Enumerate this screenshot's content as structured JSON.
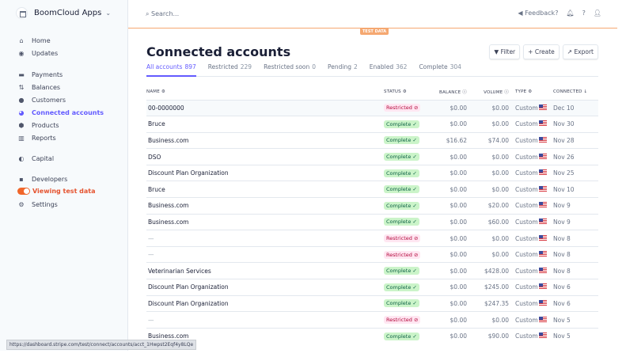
{
  "sidebar": {
    "brand": "BoomCloud Apps",
    "items": [
      {
        "label": "Home",
        "icon": "home-icon"
      },
      {
        "label": "Updates",
        "icon": "updates-icon"
      },
      {
        "label": "Payments",
        "icon": "payments-icon"
      },
      {
        "label": "Balances",
        "icon": "balances-icon"
      },
      {
        "label": "Customers",
        "icon": "customers-icon"
      },
      {
        "label": "Connected accounts",
        "icon": "connected-icon"
      },
      {
        "label": "Products",
        "icon": "products-icon"
      },
      {
        "label": "Reports",
        "icon": "reports-icon"
      },
      {
        "label": "Capital",
        "icon": "capital-icon"
      },
      {
        "label": "Developers",
        "icon": "developers-icon"
      },
      {
        "label": "Viewing test data",
        "icon": "toggle"
      },
      {
        "label": "Settings",
        "icon": "gear-icon"
      }
    ]
  },
  "topbar": {
    "search_placeholder": "Search...",
    "feedback": "Feedback?",
    "test_badge": "TEST DATA"
  },
  "page": {
    "title": "Connected accounts",
    "filter": "Filter",
    "create": "Create",
    "export": "Export"
  },
  "tabs": [
    {
      "label": "All accounts",
      "count": "897"
    },
    {
      "label": "Restricted",
      "count": "229"
    },
    {
      "label": "Restricted soon",
      "count": "0"
    },
    {
      "label": "Pending",
      "count": "2"
    },
    {
      "label": "Enabled",
      "count": "362"
    },
    {
      "label": "Complete",
      "count": "304"
    }
  ],
  "columns": {
    "name": "NAME",
    "status": "STATUS",
    "balance": "BALANCE",
    "volume": "VOLUME",
    "type": "TYPE",
    "connected": "CONNECTED"
  },
  "rows": [
    {
      "name": "00-0000000",
      "status": "Restricted",
      "balance": "$0.00",
      "volume": "$0.00",
      "type": "Custom",
      "connected": "Dec 10"
    },
    {
      "name": "Bruce",
      "status": "Complete",
      "balance": "$0.00",
      "volume": "$0.00",
      "type": "Custom",
      "connected": "Nov 30"
    },
    {
      "name": "Business.com",
      "status": "Complete",
      "balance": "$16.62",
      "volume": "$74.00",
      "type": "Custom",
      "connected": "Nov 28"
    },
    {
      "name": "DSO",
      "status": "Complete",
      "balance": "$0.00",
      "volume": "$0.00",
      "type": "Custom",
      "connected": "Nov 26"
    },
    {
      "name": "Discount Plan Organization",
      "status": "Complete",
      "balance": "$0.00",
      "volume": "$0.00",
      "type": "Custom",
      "connected": "Nov 25"
    },
    {
      "name": "Bruce",
      "status": "Complete",
      "balance": "$0.00",
      "volume": "$0.00",
      "type": "Custom",
      "connected": "Nov 10"
    },
    {
      "name": "Business.com",
      "status": "Complete",
      "balance": "$0.00",
      "volume": "$20.00",
      "type": "Custom",
      "connected": "Nov 9"
    },
    {
      "name": "Business.com",
      "status": "Complete",
      "balance": "$0.00",
      "volume": "$60.00",
      "type": "Custom",
      "connected": "Nov 9"
    },
    {
      "name": "—",
      "status": "Restricted",
      "balance": "$0.00",
      "volume": "$0.00",
      "type": "Custom",
      "connected": "Nov 8"
    },
    {
      "name": "—",
      "status": "Restricted",
      "balance": "$0.00",
      "volume": "$0.00",
      "type": "Custom",
      "connected": "Nov 8"
    },
    {
      "name": "Veterinarian Services",
      "status": "Complete",
      "balance": "$0.00",
      "volume": "$428.00",
      "type": "Custom",
      "connected": "Nov 8"
    },
    {
      "name": "Discount Plan Organization",
      "status": "Complete",
      "balance": "$0.00",
      "volume": "$245.00",
      "type": "Custom",
      "connected": "Nov 6"
    },
    {
      "name": "Discount Plan Organization",
      "status": "Complete",
      "balance": "$0.00",
      "volume": "$247.35",
      "type": "Custom",
      "connected": "Nov 6"
    },
    {
      "name": "—",
      "status": "Restricted",
      "balance": "$0.00",
      "volume": "$0.00",
      "type": "Custom",
      "connected": "Nov 5"
    },
    {
      "name": "Business.com",
      "status": "Complete",
      "balance": "$0.00",
      "volume": "$90.00",
      "type": "Custom",
      "connected": "Nov 5"
    }
  ],
  "status_bar_url": "https://dashboard.stripe.com/test/connect/accounts/acct_1Hwpst2Eqf4y8LQe"
}
